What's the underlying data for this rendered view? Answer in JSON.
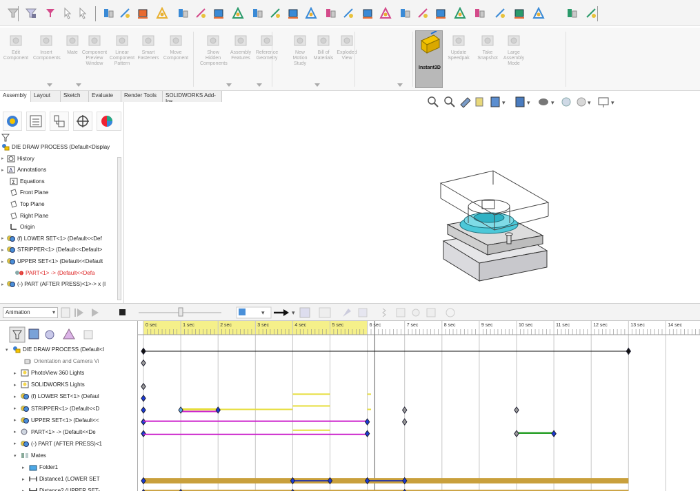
{
  "tabs": [
    {
      "label": "Assembly",
      "active": true
    },
    {
      "label": "Layout",
      "active": false
    },
    {
      "label": "Sketch",
      "active": false
    },
    {
      "label": "Evaluate",
      "active": false
    },
    {
      "label": "Render Tools",
      "active": false
    },
    {
      "label": "SOLIDWORKS Add-Ins",
      "active": false
    }
  ],
  "ribbon": {
    "buttons": [
      {
        "label": "Edit\nComponent",
        "icon": "edit-component-icon"
      },
      {
        "label": "Insert\nComponents",
        "icon": "insert-components-icon"
      },
      {
        "label": "Mate",
        "icon": "mate-icon"
      },
      {
        "label": "Component\nPreview\nWindow",
        "icon": "preview-window-icon"
      },
      {
        "label": "Linear\nComponent\nPattern",
        "icon": "linear-pattern-icon"
      },
      {
        "label": "Smart\nFasteners",
        "icon": "smart-fasteners-icon"
      },
      {
        "label": "Move\nComponent",
        "icon": "move-component-icon"
      },
      {
        "label": "Show\nHidden\nComponents",
        "icon": "show-hidden-icon"
      },
      {
        "label": "Assembly\nFeatures",
        "icon": "assembly-features-icon"
      },
      {
        "label": "Reference\nGeometry",
        "icon": "reference-geometry-icon"
      },
      {
        "label": "New\nMotion\nStudy",
        "icon": "motion-study-icon"
      },
      {
        "label": "Bill of\nMaterials",
        "icon": "bom-icon"
      },
      {
        "label": "Exploded\nView",
        "icon": "exploded-view-icon"
      },
      {
        "label": "Update\nSpeedpak",
        "icon": "speedpak-icon"
      },
      {
        "label": "Take\nSnapshot",
        "icon": "snapshot-icon"
      },
      {
        "label": "Large\nAssembly\nMode",
        "icon": "large-assembly-icon"
      }
    ],
    "instant3d_label": "Instant3D"
  },
  "feature_tree": [
    {
      "label": "DIE DRAW PROCESS  (Default<Display",
      "icon": "assembly-icon"
    },
    {
      "label": "History",
      "icon": "history-icon"
    },
    {
      "label": "Annotations",
      "icon": "annotations-icon"
    },
    {
      "label": "Equations",
      "icon": "equations-icon"
    },
    {
      "label": "Front Plane",
      "icon": "plane-icon"
    },
    {
      "label": "Top Plane",
      "icon": "plane-icon"
    },
    {
      "label": "Right Plane",
      "icon": "plane-icon"
    },
    {
      "label": "Origin",
      "icon": "origin-icon"
    },
    {
      "label": "(f) LOWER SET<1> (Default<<Def",
      "icon": "subassembly-icon"
    },
    {
      "label": "STRIPPER<1> (Default<<Default>",
      "icon": "subassembly-icon"
    },
    {
      "label": "UPPER SET<1> (Default<<Default",
      "icon": "subassembly-icon"
    },
    {
      "label": "PART<1> -> (Default<<Defa",
      "icon": "part-error-icon"
    },
    {
      "label": "(-) PART (AFTER PRESS)<1>-> x (I",
      "icon": "subassembly-icon"
    }
  ],
  "animation": {
    "type_label": "Animation"
  },
  "motion_tree": [
    {
      "label": "DIE DRAW PROCESS  (Default<I",
      "icon": "assembly-icon"
    },
    {
      "label": "Orientation and Camera Vi",
      "icon": "camera-icon"
    },
    {
      "label": "PhotoView 360 Lights",
      "icon": "lights-icon"
    },
    {
      "label": "SOLIDWORKS Lights",
      "icon": "lights-icon"
    },
    {
      "label": "(f) LOWER SET<1> (Defaul",
      "icon": "subassembly-icon"
    },
    {
      "label": "STRIPPER<1> (Default<<D",
      "icon": "subassembly-icon"
    },
    {
      "label": "UPPER SET<1> (Default<<",
      "icon": "subassembly-icon"
    },
    {
      "label": "PART<1> -> (Default<<De",
      "icon": "part-icon"
    },
    {
      "label": "(-) PART (AFTER PRESS)<1",
      "icon": "subassembly-icon"
    },
    {
      "label": "Mates",
      "icon": "mates-icon"
    },
    {
      "label": "Folder1",
      "icon": "folder-icon"
    },
    {
      "label": "Distance1 (LOWER SET",
      "icon": "distance-mate-icon"
    },
    {
      "label": "Distance2 (UPPER SET-",
      "icon": "distance-mate-icon"
    }
  ],
  "timeline": {
    "ticks": [
      "0 sec",
      "1 sec",
      "2 sec",
      "3 sec",
      "4 sec",
      "5 sec",
      "6 sec",
      "7 sec",
      "8 sec",
      "9 sec",
      "10 sec",
      "11 sec",
      "12 sec",
      "13 sec",
      "14 sec"
    ]
  },
  "colors": {
    "timeline_header": "#f5f08a",
    "bar_yellow": "#e6dd3a",
    "bar_magenta": "#cc22cc",
    "bar_green": "#2aa02a",
    "bar_gold": "#c9a03c",
    "bar_navy": "#2233aa",
    "key_blue": "#1a3ad6"
  }
}
